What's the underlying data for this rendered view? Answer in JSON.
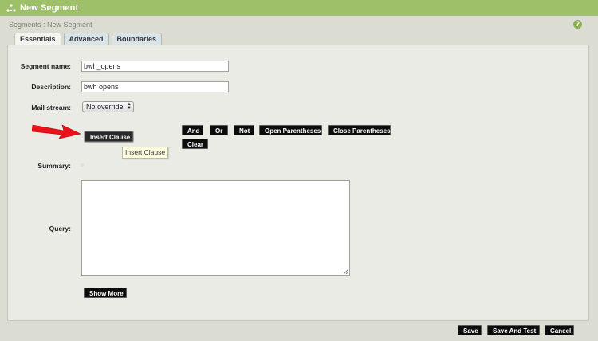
{
  "window": {
    "title": "New Segment"
  },
  "breadcrumb": "Segments : New Segment",
  "help_icon": "?",
  "tabs": [
    {
      "label": "Essentials",
      "active": true
    },
    {
      "label": "Advanced",
      "active": false
    },
    {
      "label": "Boundaries",
      "active": false
    }
  ],
  "form": {
    "segment_name": {
      "label": "Segment name:",
      "value": "bwh_opens"
    },
    "description": {
      "label": "Description:",
      "value": "bwh opens"
    },
    "mail_stream": {
      "label": "Mail stream:",
      "value": "No override"
    },
    "summary_label": "Summary:",
    "query_label": "Query:"
  },
  "clause": {
    "insert_label": "Insert Clause",
    "tooltip": "Insert Clause",
    "and_label": "And",
    "or_label": "Or",
    "not_label": "Not",
    "open_paren_label": "Open Parentheses",
    "close_paren_label": "Close Parentheses",
    "clear_label": "Clear"
  },
  "show_more_label": "Show More",
  "footer": {
    "save_label": "Save",
    "save_and_test_label": "Save And Test",
    "cancel_label": "Cancel"
  },
  "colors": {
    "titlebar": "#9dc069",
    "button": "#0c0c0c",
    "arrow": "#e8131a"
  }
}
